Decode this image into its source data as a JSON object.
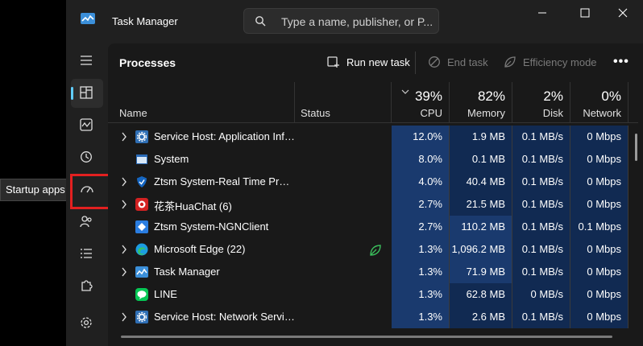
{
  "app": {
    "title": "Task Manager"
  },
  "search": {
    "placeholder": "Type a name, publisher, or P..."
  },
  "tooltip": "Startup apps",
  "page": {
    "title": "Processes"
  },
  "toolbar": {
    "run_new_task": "Run new task",
    "end_task": "End task",
    "efficiency_mode": "Efficiency mode"
  },
  "columns": {
    "name": "Name",
    "status": "Status",
    "cpu": {
      "pct": "39%",
      "label": "CPU"
    },
    "memory": {
      "pct": "82%",
      "label": "Memory"
    },
    "disk": {
      "pct": "2%",
      "label": "Disk"
    },
    "network": {
      "pct": "0%",
      "label": "Network"
    }
  },
  "colors": {
    "accent": "#60cdff",
    "highlight": "#e32020",
    "cell_blue": "#1a3a6e",
    "cell_blue_dark": "#112a52"
  },
  "processes": [
    {
      "name": "Service Host: Application Infor...",
      "cpu": "12.0%",
      "memory": "1.9 MB",
      "disk": "0.1 MB/s",
      "network": "0 Mbps",
      "expandable": true,
      "icon": "gear-icon"
    },
    {
      "name": "System",
      "cpu": "8.0%",
      "memory": "0.1 MB",
      "disk": "0.1 MB/s",
      "network": "0 Mbps",
      "expandable": false,
      "icon": "window-icon"
    },
    {
      "name": "Ztsm System-Real Time Prote...",
      "cpu": "4.0%",
      "memory": "40.4 MB",
      "disk": "0.1 MB/s",
      "network": "0 Mbps",
      "expandable": true,
      "icon": "shield-icon"
    },
    {
      "name": "花茶HuaChat (6)",
      "cpu": "2.7%",
      "memory": "21.5 MB",
      "disk": "0.1 MB/s",
      "network": "0 Mbps",
      "expandable": true,
      "icon": "chat-icon"
    },
    {
      "name": "Ztsm System-NGNClient",
      "cpu": "2.7%",
      "memory": "110.2 MB",
      "disk": "0.1 MB/s",
      "network": "0.1 Mbps",
      "expandable": false,
      "icon": "diamond-icon"
    },
    {
      "name": "Microsoft Edge (22)",
      "cpu": "1.3%",
      "memory": "1,096.2 MB",
      "disk": "0.1 MB/s",
      "network": "0 Mbps",
      "expandable": true,
      "icon": "edge-icon",
      "status": "efficiency-leaf-icon"
    },
    {
      "name": "Task Manager",
      "cpu": "1.3%",
      "memory": "71.9 MB",
      "disk": "0.1 MB/s",
      "network": "0 Mbps",
      "expandable": true,
      "icon": "task-manager-icon"
    },
    {
      "name": "LINE",
      "cpu": "1.3%",
      "memory": "62.8 MB",
      "disk": "0 MB/s",
      "network": "0 Mbps",
      "expandable": false,
      "icon": "line-icon"
    },
    {
      "name": "Service Host: Network Service",
      "cpu": "1.3%",
      "memory": "2.6 MB",
      "disk": "0.1 MB/s",
      "network": "0 Mbps",
      "expandable": true,
      "icon": "gear-icon"
    }
  ]
}
